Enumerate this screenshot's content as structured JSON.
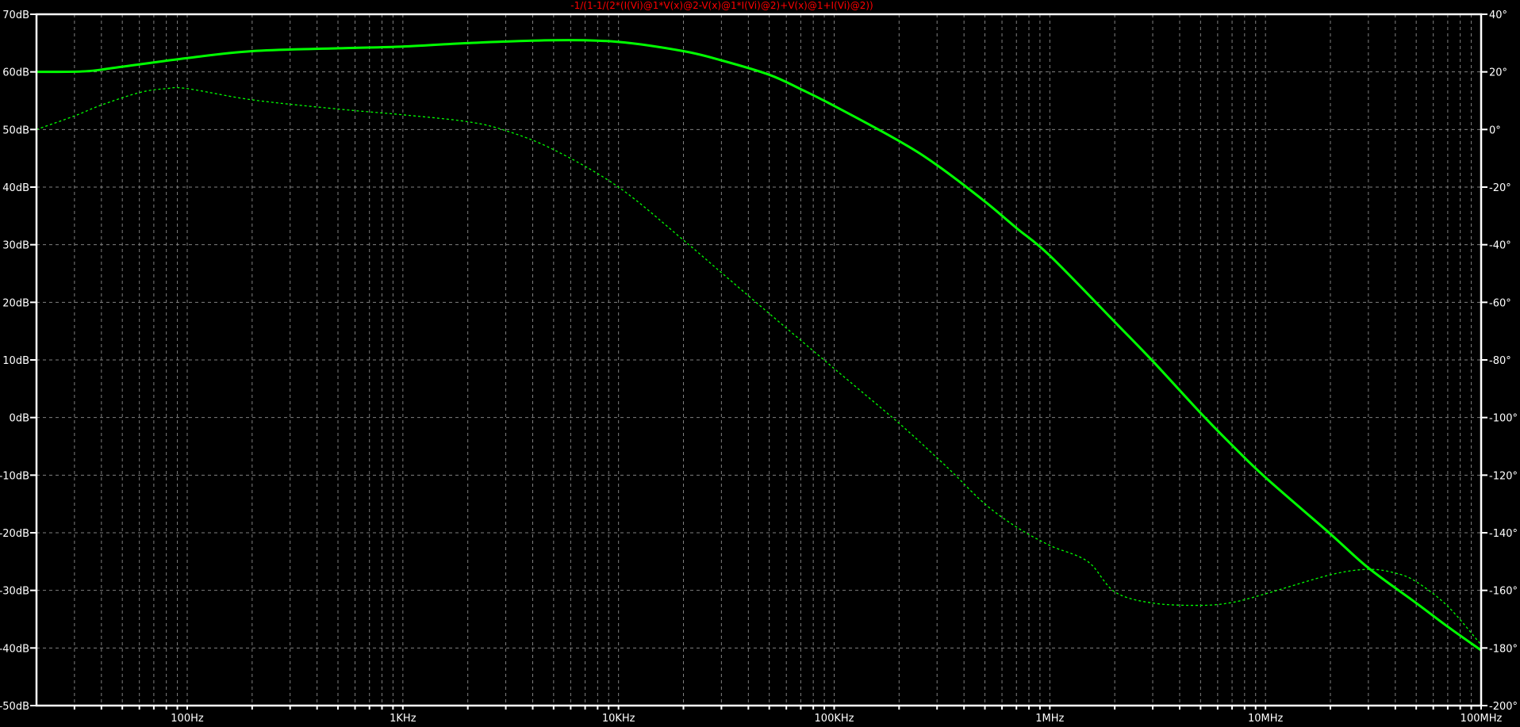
{
  "chart_data": {
    "type": "line",
    "title": "-1/(1-1/(2*(I(Vi)@1*V(x)@2-V(x)@1*I(Vi)@2)+V(x)@1+I(Vi)@2))",
    "xscale": "log",
    "xlim": [
      20,
      100000000
    ],
    "ylim_left": [
      -50,
      70
    ],
    "ylim_right": [
      -200,
      40
    ],
    "grid": true,
    "x_ticks": [
      {
        "value": 100,
        "label": "100Hz"
      },
      {
        "value": 1000,
        "label": "1KHz"
      },
      {
        "value": 10000,
        "label": "10KHz"
      },
      {
        "value": 100000,
        "label": "100KHz"
      },
      {
        "value": 1000000,
        "label": "1MHz"
      },
      {
        "value": 10000000,
        "label": "10MHz"
      },
      {
        "value": 100000000,
        "label": "100MHz"
      }
    ],
    "y_left_ticks": [
      "70dB",
      "60dB",
      "50dB",
      "40dB",
      "30dB",
      "20dB",
      "10dB",
      "0dB",
      "-10dB",
      "-20dB",
      "-30dB",
      "-40dB",
      "-50dB"
    ],
    "y_right_ticks": [
      "40°",
      "20°",
      "0°",
      "-20°",
      "-40°",
      "-60°",
      "-80°",
      "-100°",
      "-120°",
      "-140°",
      "-160°",
      "-180°",
      "-200°"
    ],
    "colors": {
      "background": "#000000",
      "trace": "#00ff00",
      "grid": "#808080",
      "axis": "#ffffff",
      "title": "#ff0000"
    },
    "series": [
      {
        "axis": "left",
        "unit": "dB",
        "style": "solid",
        "points": [
          [
            20,
            60
          ],
          [
            33.6,
            60.1
          ],
          [
            50,
            60.9
          ],
          [
            100,
            62.4
          ],
          [
            200,
            63.6
          ],
          [
            500,
            64.1
          ],
          [
            1000,
            64.4
          ],
          [
            2000,
            65
          ],
          [
            5000,
            65.5
          ],
          [
            10000,
            65.2
          ],
          [
            20000,
            63.6
          ],
          [
            30000,
            62
          ],
          [
            50000,
            59.5
          ],
          [
            70000,
            57
          ],
          [
            100000,
            54.1
          ],
          [
            200000,
            48
          ],
          [
            300000,
            43.8
          ],
          [
            500000,
            37.5
          ],
          [
            700000,
            32.9
          ],
          [
            1000000,
            28.1
          ],
          [
            2000000,
            16.6
          ],
          [
            3000000,
            9.8
          ],
          [
            5000000,
            0.8
          ],
          [
            7000000,
            -4.8
          ],
          [
            10000000,
            -10.4
          ],
          [
            20000000,
            -20.2
          ],
          [
            30000000,
            -26.1
          ],
          [
            50000000,
            -32.2
          ],
          [
            70000000,
            -36.3
          ],
          [
            100000000,
            -40.4
          ]
        ]
      },
      {
        "axis": "right",
        "unit": "deg",
        "style": "dotted",
        "points": [
          [
            20,
            0
          ],
          [
            30,
            4.7
          ],
          [
            40,
            8.5
          ],
          [
            60,
            12.8
          ],
          [
            80,
            14.2
          ],
          [
            100,
            14.2
          ],
          [
            200,
            10.3
          ],
          [
            500,
            7.1
          ],
          [
            1000,
            5.1
          ],
          [
            2000,
            2.7
          ],
          [
            3000,
            -0.4
          ],
          [
            5000,
            -7
          ],
          [
            10000,
            -20
          ],
          [
            20000,
            -38.4
          ],
          [
            30000,
            -49.7
          ],
          [
            50000,
            -63.9
          ],
          [
            100000,
            -83
          ],
          [
            200000,
            -102
          ],
          [
            300000,
            -114
          ],
          [
            360000,
            -119.6
          ],
          [
            500000,
            -130
          ],
          [
            700000,
            -138
          ],
          [
            1000000,
            -144.4
          ],
          [
            1500000,
            -150
          ],
          [
            2000000,
            -160.5
          ],
          [
            3000000,
            -164.4
          ],
          [
            5000000,
            -165.2
          ],
          [
            7000000,
            -164.2
          ],
          [
            10000000,
            -161.2
          ],
          [
            20000000,
            -154.6
          ],
          [
            30000000,
            -152.7
          ],
          [
            40000000,
            -154
          ],
          [
            50000000,
            -157
          ],
          [
            70000000,
            -165.5
          ],
          [
            100000000,
            -178.9
          ]
        ]
      }
    ]
  }
}
